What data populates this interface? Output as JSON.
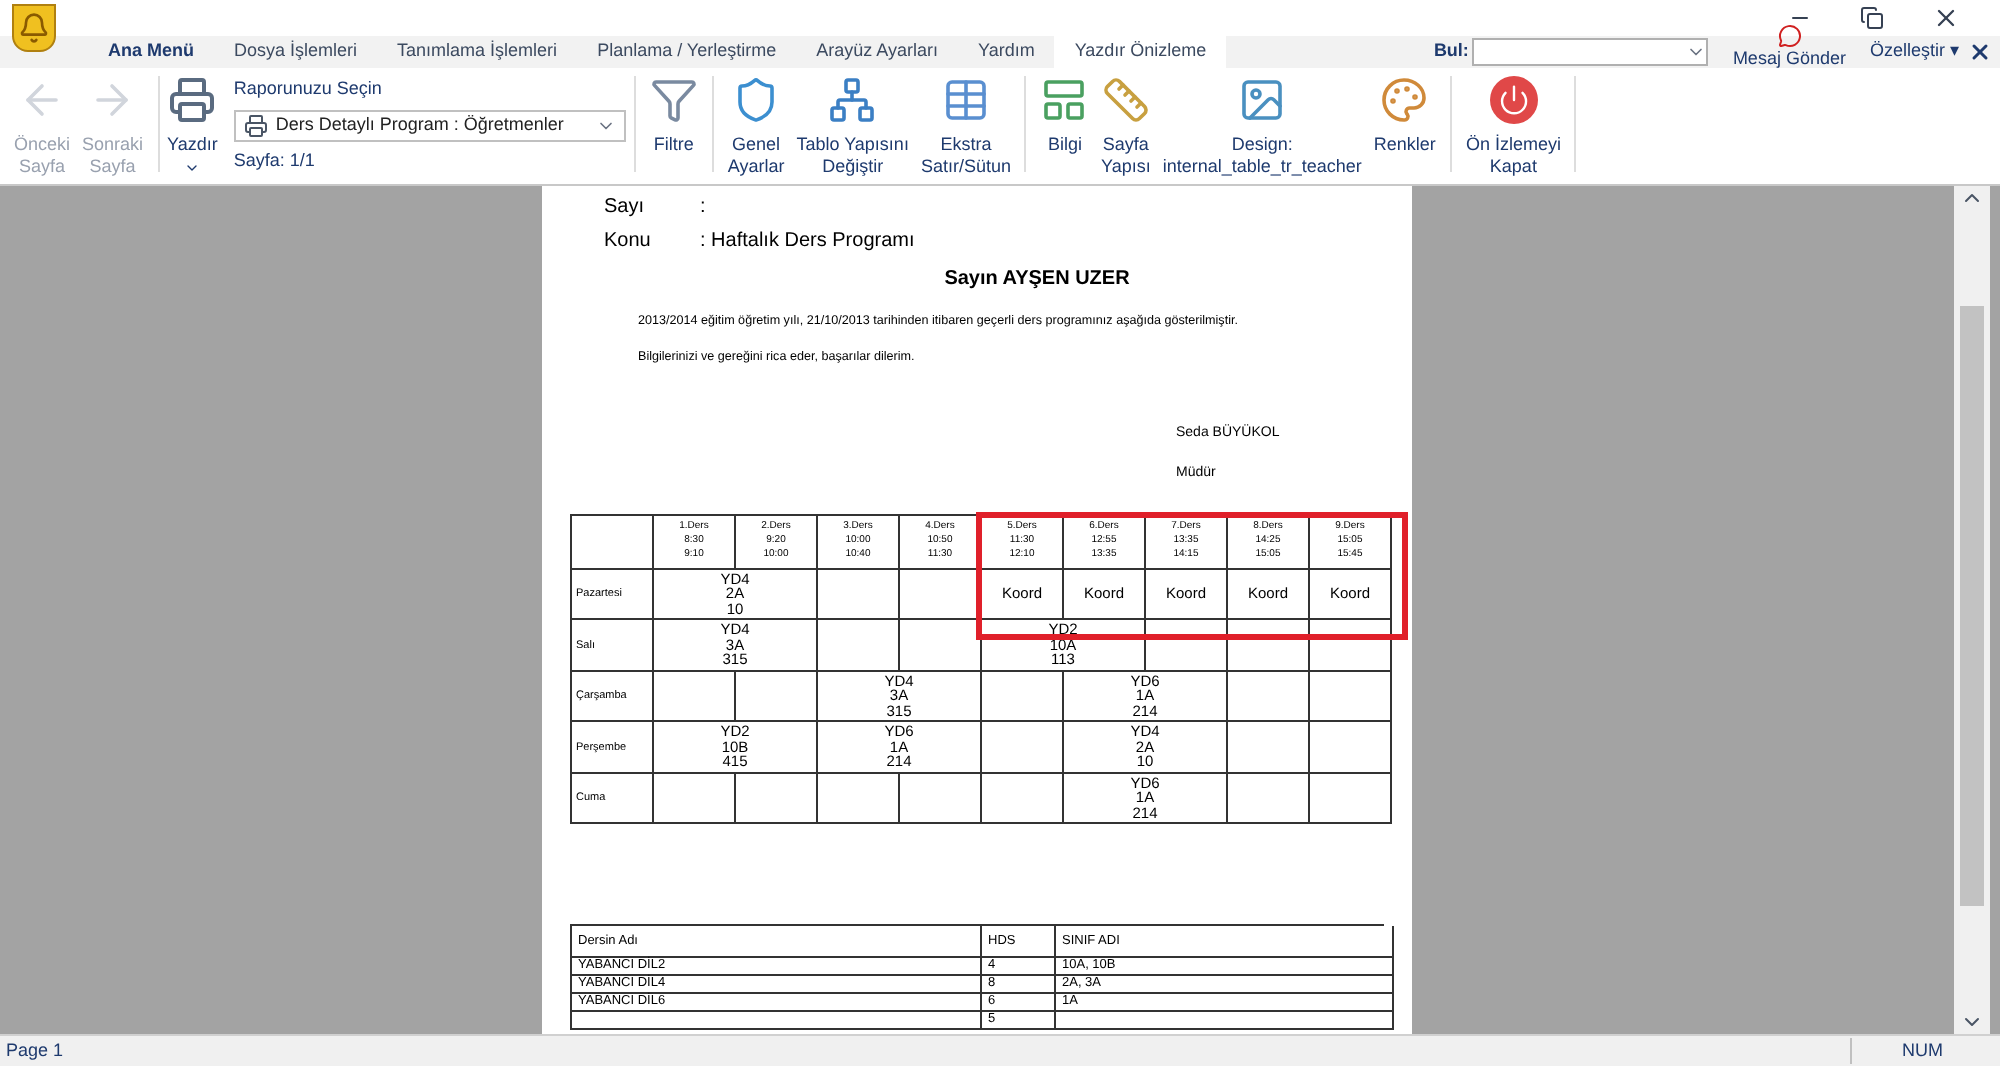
{
  "menu_tabs": [
    {
      "label": "Ana Menü",
      "kind": "app",
      "selected": false
    },
    {
      "label": "Dosya İşlemleri",
      "kind": "tab",
      "selected": false
    },
    {
      "label": "Tanımlama İşlemleri",
      "kind": "tab",
      "selected": false
    },
    {
      "label": "Planlama / Yerleştirme",
      "kind": "tab",
      "selected": false
    },
    {
      "label": "Arayüz Ayarları",
      "kind": "tab",
      "selected": false
    },
    {
      "label": "Yardım",
      "kind": "tab",
      "selected": false
    },
    {
      "label": "Yazdır Önizleme",
      "kind": "tab",
      "selected": true
    }
  ],
  "find": {
    "label": "Bul:"
  },
  "send_message": "Mesaj Gönder",
  "customize": "Özelleştir",
  "customize_caret": "▾",
  "ribbon": {
    "nav": [
      {
        "label": "Önceki\nSayfa",
        "disabled": true
      },
      {
        "label": "Sonraki\nSayfa",
        "disabled": true
      }
    ],
    "print": "Yazdır",
    "report_label": "Raporunuzu Seçin",
    "report_value": "Ders Detaylı Program : Öğretmenler",
    "page_info": "Sayfa: 1/1",
    "groups": [
      [
        {
          "label": "Filtre"
        }
      ],
      [
        {
          "label": "Genel\nAyarlar"
        },
        {
          "label": "Tablo Yapısını\nDeğiştir"
        },
        {
          "label": "Ekstra\nSatır/Sütun"
        }
      ],
      [
        {
          "label": "Bilgi"
        },
        {
          "label": "Sayfa\nYapısı"
        },
        {
          "label": "Design:\ninternal_table_tr_teacher"
        },
        {
          "label": "Renkler"
        }
      ],
      [
        {
          "label": "Ön İzlemeyi\nKapat"
        }
      ]
    ]
  },
  "document": {
    "fields": [
      {
        "label": "Sayı",
        "value": ":"
      },
      {
        "label": "Konu",
        "value": ": Haftalık Ders Programı"
      }
    ],
    "salutation": "Sayın AYŞEN UZER",
    "paragraphs": [
      "2013/2014 eğitim öğretim yılı, 21/10/2013 tarihinden itibaren geçerli ders programınız aşağıda gösterilmiştir.",
      "Bilgilerinizi ve gereğini rica eder, başarılar dilerim."
    ],
    "signer": "Seda BÜYÜKOL",
    "signer_title": "Müdür",
    "timetable": {
      "periods": [
        {
          "name": "1.Ders",
          "start": "8:30",
          "end": "9:10"
        },
        {
          "name": "2.Ders",
          "start": "9:20",
          "end": "10:00"
        },
        {
          "name": "3.Ders",
          "start": "10:00",
          "end": "10:40"
        },
        {
          "name": "4.Ders",
          "start": "10:50",
          "end": "11:30"
        },
        {
          "name": "5.Ders",
          "start": "11:30",
          "end": "12:10"
        },
        {
          "name": "6.Ders",
          "start": "12:55",
          "end": "13:35"
        },
        {
          "name": "7.Ders",
          "start": "13:35",
          "end": "14:15"
        },
        {
          "name": "8.Ders",
          "start": "14:25",
          "end": "15:05"
        },
        {
          "name": "9.Ders",
          "start": "15:05",
          "end": "15:45"
        }
      ],
      "days": [
        {
          "day": "Pazartesi",
          "cells": [
            {
              "kind": "double",
              "lines": [
                "YD4",
                "2A",
                "10"
              ]
            },
            {
              "kind": "single"
            },
            {
              "kind": "single"
            },
            {
              "kind": "single",
              "lines": [
                "Koord"
              ]
            },
            {
              "kind": "single",
              "lines": [
                "Koord"
              ]
            },
            {
              "kind": "single",
              "lines": [
                "Koord"
              ]
            },
            {
              "kind": "single",
              "lines": [
                "Koord"
              ]
            },
            {
              "kind": "single",
              "lines": [
                "Koord"
              ]
            }
          ]
        },
        {
          "day": "Salı",
          "cells": [
            {
              "kind": "double",
              "lines": [
                "YD4",
                "3A",
                "315"
              ]
            },
            {
              "kind": "single"
            },
            {
              "kind": "single"
            },
            {
              "kind": "double",
              "lines": [
                "YD2",
                "10A",
                "113"
              ]
            },
            {
              "kind": "single"
            },
            {
              "kind": "single"
            },
            {
              "kind": "single"
            }
          ]
        },
        {
          "day": "Çarşamba",
          "cells": [
            {
              "kind": "single"
            },
            {
              "kind": "single"
            },
            {
              "kind": "double",
              "lines": [
                "YD4",
                "3A",
                "315"
              ]
            },
            {
              "kind": "single"
            },
            {
              "kind": "double",
              "lines": [
                "YD6",
                "1A",
                "214"
              ]
            },
            {
              "kind": "single"
            },
            {
              "kind": "single"
            }
          ]
        },
        {
          "day": "Perşembe",
          "cells": [
            {
              "kind": "double",
              "lines": [
                "YD2",
                "10B",
                "415"
              ]
            },
            {
              "kind": "double",
              "lines": [
                "YD6",
                "1A",
                "214"
              ]
            },
            {
              "kind": "single"
            },
            {
              "kind": "double",
              "lines": [
                "YD4",
                "2A",
                "10"
              ]
            },
            {
              "kind": "single"
            },
            {
              "kind": "single"
            }
          ]
        },
        {
          "day": "Cuma",
          "cells": [
            {
              "kind": "single"
            },
            {
              "kind": "single"
            },
            {
              "kind": "single"
            },
            {
              "kind": "single"
            },
            {
              "kind": "single"
            },
            {
              "kind": "double",
              "lines": [
                "YD6",
                "1A",
                "214"
              ]
            },
            {
              "kind": "single"
            },
            {
              "kind": "single"
            }
          ]
        }
      ]
    },
    "summary": {
      "columns": [
        "Dersin Adı",
        "HDS",
        "SINIF ADI"
      ],
      "rows": [
        [
          "YABANCI DİL2",
          "4",
          "10A, 10B"
        ],
        [
          "YABANCI DİL4",
          "8",
          "2A, 3A"
        ],
        [
          "YABANCI DİL6",
          "6",
          "1A"
        ],
        [
          "",
          "5",
          ""
        ]
      ]
    }
  },
  "status_bar": {
    "page": "Page 1",
    "num": "NUM"
  }
}
